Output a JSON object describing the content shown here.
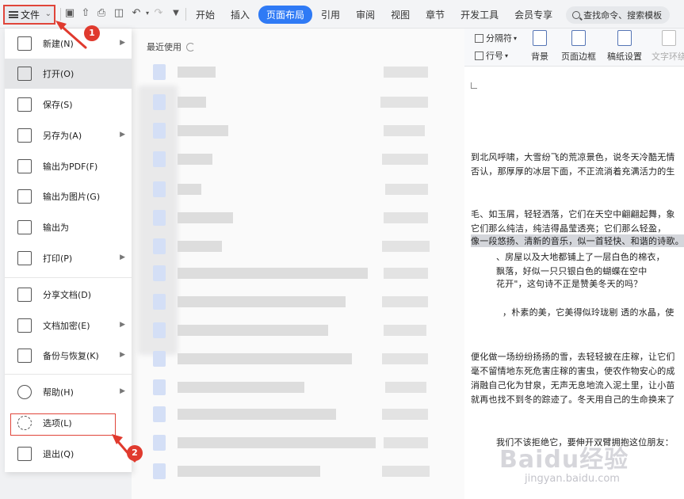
{
  "toolbar": {
    "file_label": "文件",
    "tabs": [
      "开始",
      "插入",
      "页面布局",
      "引用",
      "审阅",
      "视图",
      "章节",
      "开发工具",
      "会员专享"
    ],
    "active_tab": "页面布局",
    "search_placeholder": "查找命令、搜索模板"
  },
  "ribbon": {
    "separator_label": "分隔符",
    "line_number_label": "行号",
    "background_label": "背景",
    "page_border_label": "页面边框",
    "paper_settings_label": "稿纸设置",
    "text_wrap_label": "文字环绕"
  },
  "file_menu": {
    "items": [
      {
        "label": "新建(N)",
        "icon": "new-document-icon",
        "has_submenu": true
      },
      {
        "label": "打开(O)",
        "icon": "folder-open-icon",
        "has_submenu": false
      },
      {
        "label": "保存(S)",
        "icon": "save-icon",
        "has_submenu": false
      },
      {
        "label": "另存为(A)",
        "icon": "save-as-icon",
        "has_submenu": true
      },
      {
        "label": "输出为PDF(F)",
        "icon": "export-pdf-icon",
        "has_submenu": false
      },
      {
        "label": "输出为图片(G)",
        "icon": "export-image-icon",
        "has_submenu": false
      },
      {
        "label": "输出为",
        "icon": "export-icon",
        "has_submenu": false
      },
      {
        "label": "打印(P)",
        "icon": "print-icon",
        "has_submenu": true
      },
      {
        "label": "分享文档(D)",
        "icon": "share-icon",
        "has_submenu": false
      },
      {
        "label": "文档加密(E)",
        "icon": "encrypt-icon",
        "has_submenu": true
      },
      {
        "label": "备份与恢复(K)",
        "icon": "backup-icon",
        "has_submenu": true
      },
      {
        "label": "帮助(H)",
        "icon": "help-icon",
        "has_submenu": true
      },
      {
        "label": "选项(L)",
        "icon": "gear-icon",
        "has_submenu": false
      },
      {
        "label": "退出(Q)",
        "icon": "exit-icon",
        "has_submenu": false
      }
    ],
    "selected": "打开(O)",
    "highlighted": "选项(L)"
  },
  "recent": {
    "heading": "最近使用"
  },
  "document": {
    "lines": [
      "到北风呼啸，大雪纷飞的荒凉景色，说冬天冷酷无情",
      "否认，那厚厚的冰层下面，不正流淌着充满活力的生",
      "毛、如玉屑，轻轻洒落，它们在天空中翩翩起舞，象",
      "它们那么纯洁，纯洁得晶莹透亮；它们那么轻盈，",
      "像一段悠扬、清新的音乐，似一首轻快、和谐的诗歌。",
      "、房屋以及大地都铺上了一层白色的棉衣，",
      "飘落，好似一只只银白色的蝴蝶在空中",
      "花开\"，这句诗不正是赞美冬天的吗？",
      "，朴素的美，它美得似玲珑剔 透的水晶，使",
      "便化做一场纷纷扬扬的雪，去轻轻披在庄稼，让它们",
      "毫不留情地东死危害庄稼的害虫，使农作物安心的成",
      "消融自己化为甘泉，无声无息地流入泥土里，让小苗",
      "就再也找不到冬的踪迹了。冬天用自己的生命换来了",
      "我们不该拒绝它，要伸开双臂拥抱这位朋友："
    ]
  },
  "callouts": [
    "1",
    "2"
  ],
  "watermark": {
    "main": "Baidu经验",
    "sub": "jingyan.baidu.com"
  },
  "colors": {
    "accent_blue": "#2f7af5",
    "callout_red": "#e03a2e"
  }
}
